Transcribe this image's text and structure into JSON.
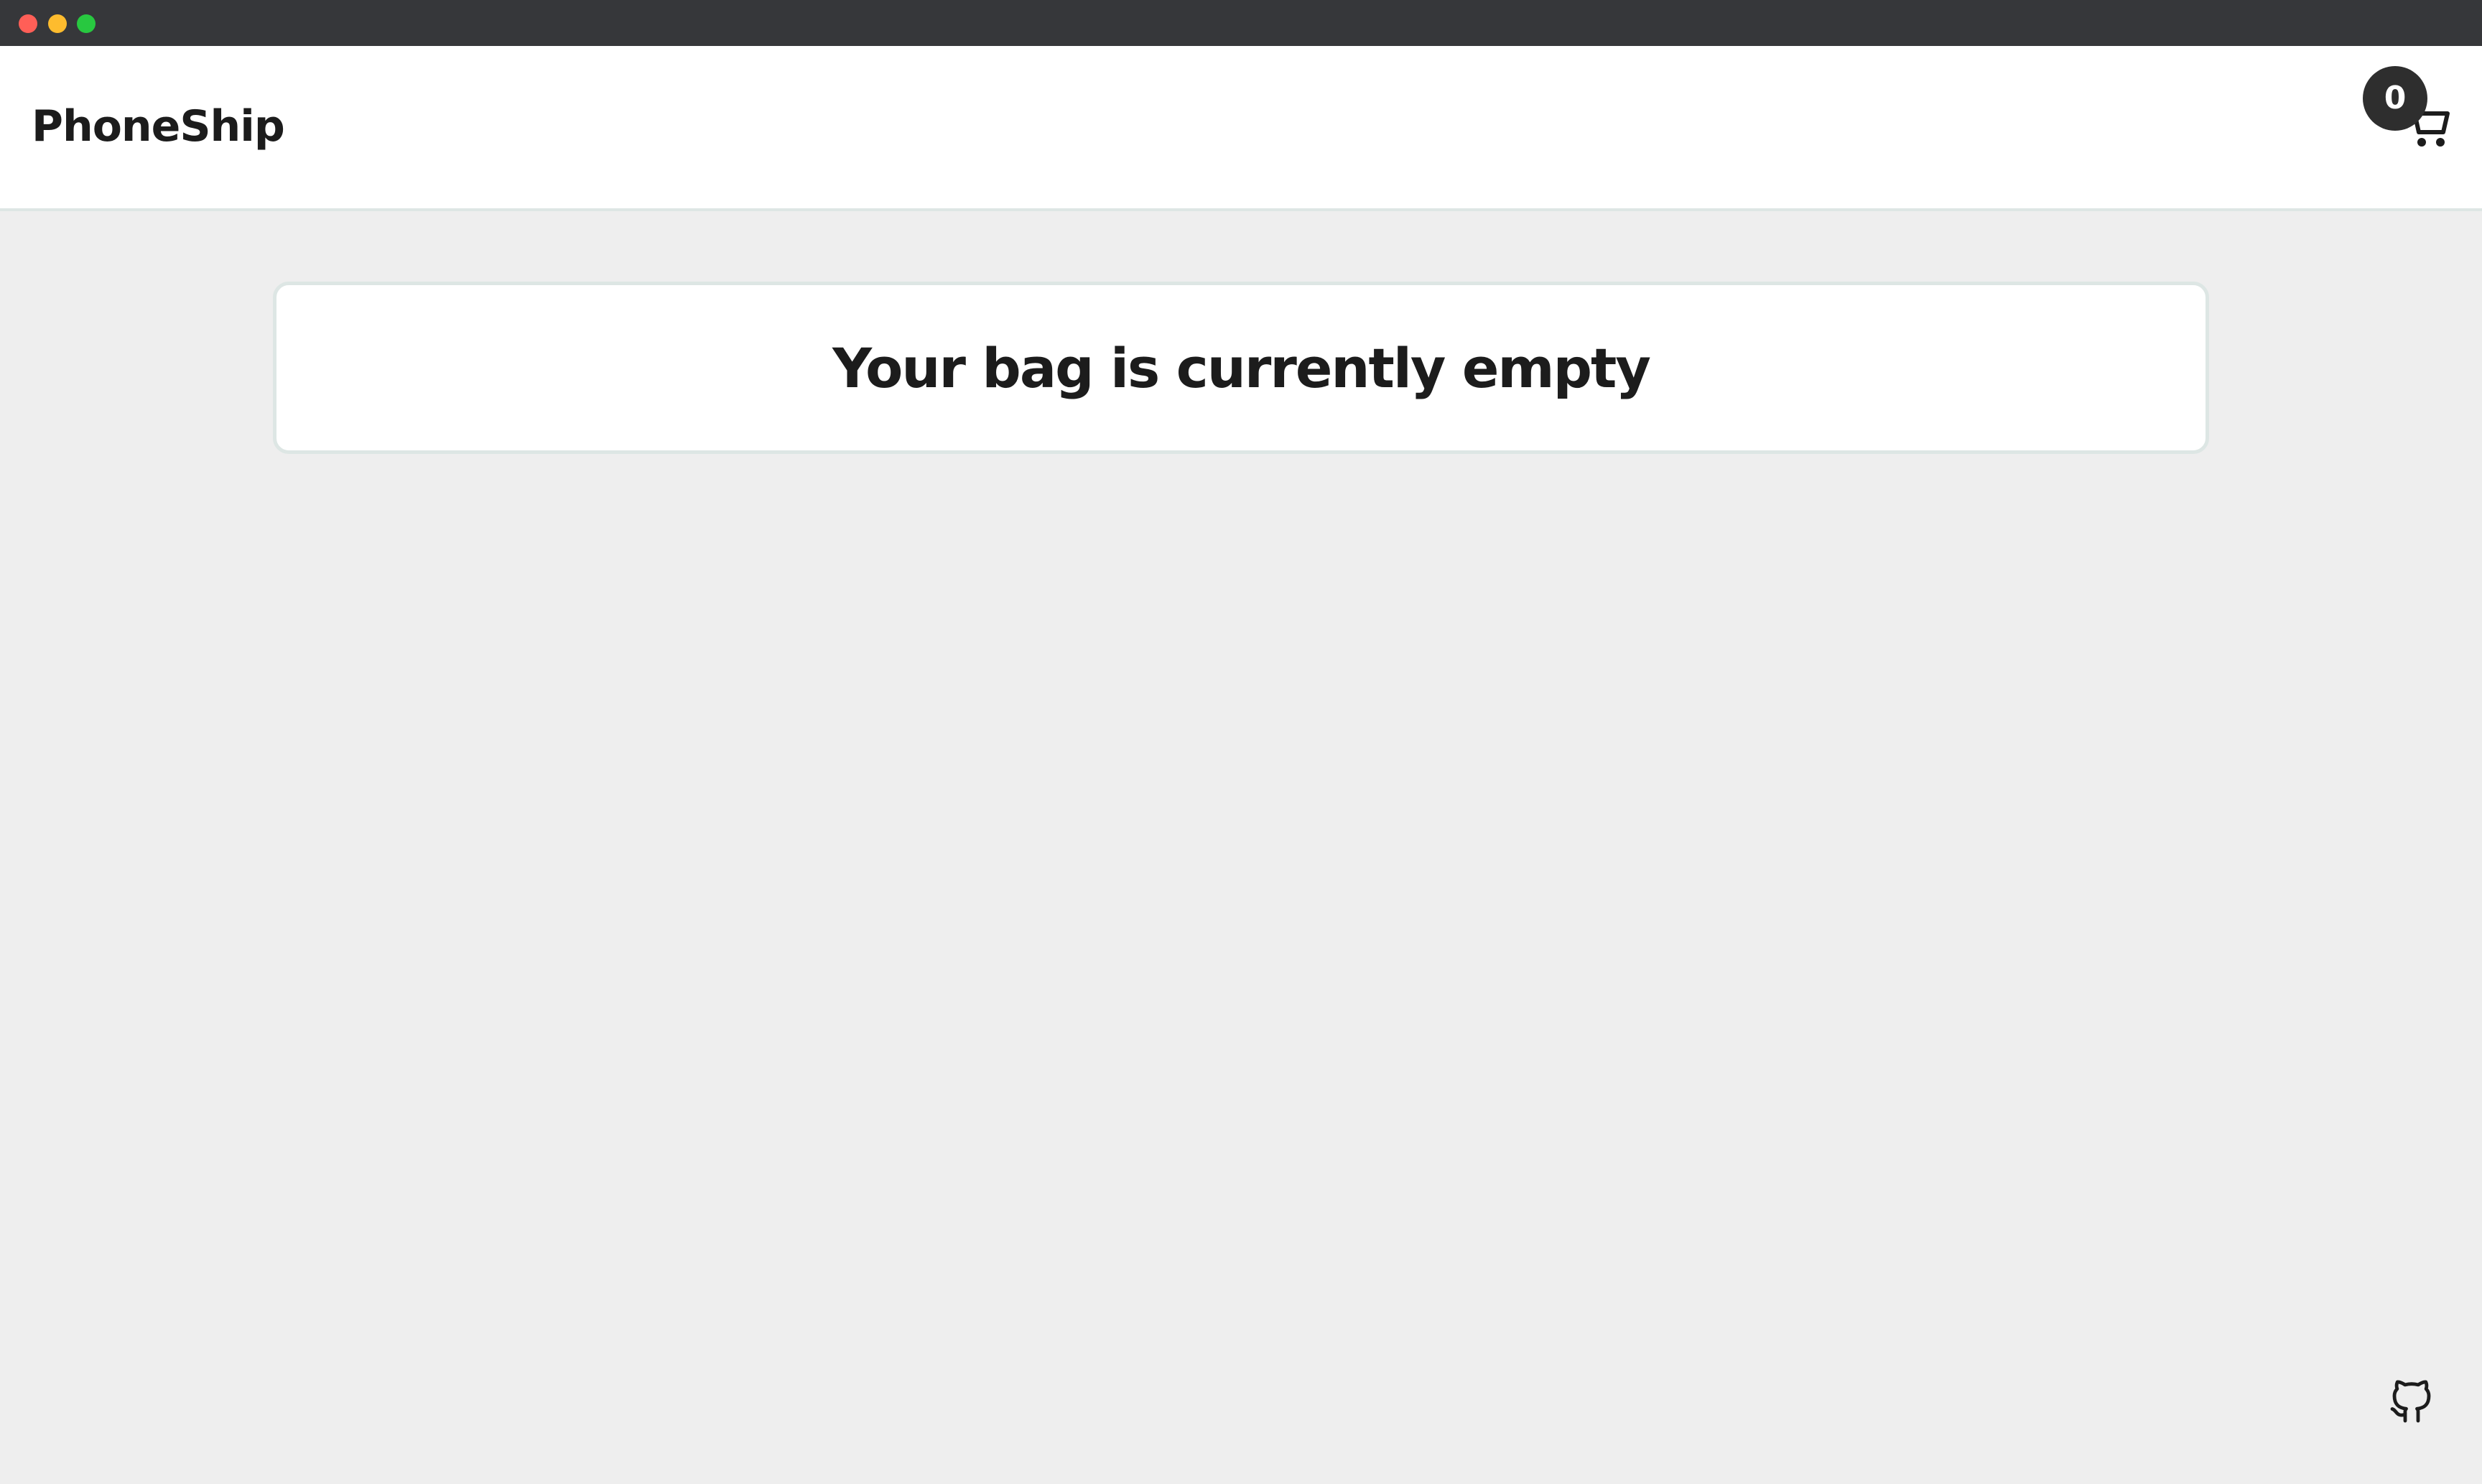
{
  "window": {
    "controls": [
      {
        "name": "close",
        "color": "#ff5f57"
      },
      {
        "name": "minimize",
        "color": "#febc2e"
      },
      {
        "name": "zoom",
        "color": "#28c840"
      }
    ]
  },
  "header": {
    "brand": "PhoneShip",
    "cart": {
      "count": "0",
      "icon": "cart-icon"
    }
  },
  "main": {
    "empty_message": "Your bag is currently empty"
  },
  "footer": {
    "icon": "github-icon"
  },
  "colors": {
    "background": "#eeeeee",
    "surface": "#ffffff",
    "border": "#dde6e4",
    "text": "#1c1c1c",
    "badge": "#2e2e2e",
    "titlebar": "#36373a"
  }
}
